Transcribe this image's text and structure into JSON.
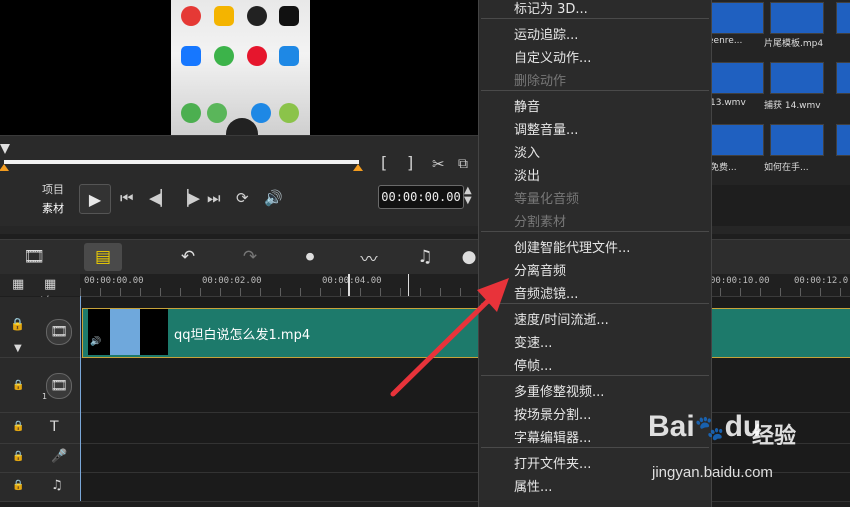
{
  "preview": {
    "mode_labels": [
      "项目",
      "素材"
    ],
    "timecode": "00:00:00.00",
    "bracket_in": "[",
    "bracket_out": "]"
  },
  "library": {
    "thumb_labels": [
      "eenre...",
      "片尾模板.mp4",
      "13.wmv",
      "捕获 14.wmv",
      "免费...",
      "如何在手..."
    ]
  },
  "ruler": {
    "ticks": [
      "00:00:00.00",
      "00:00:02.00",
      "00:00:04.00",
      "00:00:10.00",
      "00:00:12.0"
    ],
    "track_add_label": "+/−"
  },
  "timeline": {
    "clip_title": "qq坦白说怎么发1.mp4",
    "track_numbers": [
      "1"
    ]
  },
  "context_menu": {
    "items": [
      {
        "label": "标记为 3D...",
        "disabled": false
      },
      {
        "label": "运动追踪...",
        "disabled": false
      },
      {
        "label": "自定义动作...",
        "disabled": false
      },
      {
        "label": "删除动作",
        "disabled": true
      },
      {
        "label": "静音",
        "disabled": false
      },
      {
        "label": "调整音量...",
        "disabled": false
      },
      {
        "label": "淡入",
        "disabled": false
      },
      {
        "label": "淡出",
        "disabled": false
      },
      {
        "label": "等量化音频",
        "disabled": true
      },
      {
        "label": "分割素材",
        "disabled": true
      },
      {
        "label": "创建智能代理文件...",
        "disabled": false
      },
      {
        "label": "分离音频",
        "disabled": false
      },
      {
        "label": "音频滤镜...",
        "disabled": false
      },
      {
        "label": "速度/时间流逝...",
        "disabled": false
      },
      {
        "label": "变速...",
        "disabled": false
      },
      {
        "label": "停帧...",
        "disabled": false
      },
      {
        "label": "多重修整视频...",
        "disabled": false
      },
      {
        "label": "按场景分割...",
        "disabled": false
      },
      {
        "label": "字幕编辑器...",
        "disabled": false
      },
      {
        "label": "打开文件夹...",
        "disabled": false
      },
      {
        "label": "属性...",
        "disabled": false
      }
    ]
  },
  "watermark": {
    "brand": "Bai",
    "brand_tail": "du",
    "jingyan": "经验",
    "url": "jingyan.baidu.com"
  },
  "colors": {
    "clip_fill": "#1d7a6b",
    "trim_marker": "#f39c1f",
    "arrow": "#e8333a"
  }
}
